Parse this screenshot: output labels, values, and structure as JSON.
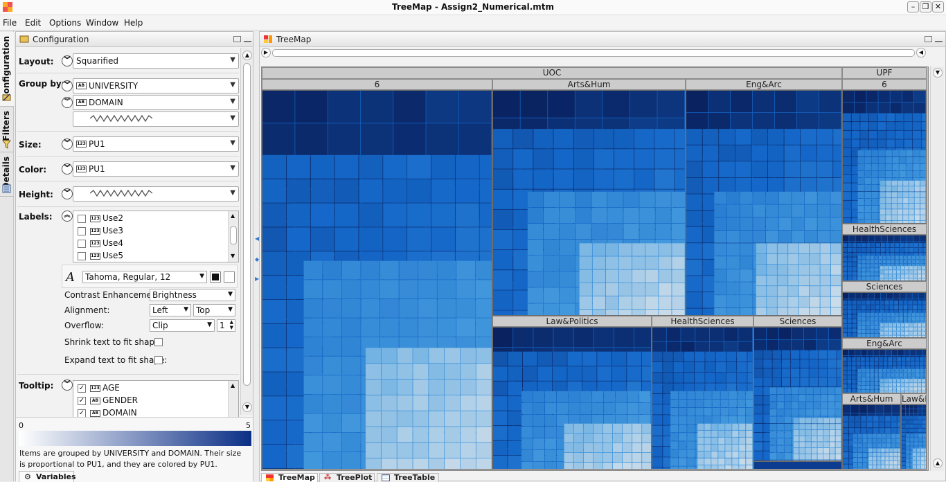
{
  "window": {
    "title": "TreeMap - Assign2_Numerical.mtm"
  },
  "menu": [
    "File",
    "Edit",
    "Options",
    "Window",
    "Help"
  ],
  "side_tabs": [
    "Configuration",
    "Filters",
    "Details"
  ],
  "config": {
    "panel_title": "Configuration",
    "layout_label": "Layout:",
    "layout_value": "Squarified",
    "group_label": "Group by:",
    "group_values": [
      "UNIVERSITY",
      "DOMAIN"
    ],
    "size_label": "Size:",
    "size_value": "PU1",
    "color_label": "Color:",
    "color_value": "PU1",
    "height_label": "Height:",
    "labels_label": "Labels:",
    "labels_items": [
      "Use2",
      "Use3",
      "Use4",
      "Use5"
    ],
    "font_value": "Tahoma, Regular, 12",
    "contrast_label": "Contrast Enhancement:",
    "contrast_value": "Brightness",
    "alignment_label": "Alignment:",
    "align_h": "Left",
    "align_v": "Top",
    "overflow_label": "Overflow:",
    "overflow_value": "Clip",
    "overflow_count": "1",
    "shrink_label": "Shrink text to fit shape:",
    "expand_label": "Expand text to fit shape:",
    "tooltip_label": "Tooltip:",
    "tooltip_items": [
      "AGE",
      "GENDER",
      "DOMAIN"
    ],
    "legend_min": "0",
    "legend_max": "5",
    "description": "Items are grouped by UNIVERSITY and DOMAIN. Their size is proportional to PU1, and they are colored by PU1.",
    "variables_tab": "Variables"
  },
  "treemap": {
    "panel_title": "TreeMap",
    "universities": [
      "UOC",
      "UPF"
    ],
    "uoc_domains": [
      "6",
      "Arts&Hum",
      "Eng&Arc",
      "Law&Politics",
      "HealthSciences",
      "Sciences"
    ],
    "upf_domains": [
      "6",
      "HealthSciences",
      "Sciences",
      "Eng&Arc",
      "Arts&Hum",
      "Law&F"
    ],
    "colors": {
      "dark": "#0a2260",
      "mid": "#1467c8",
      "light": "#4aa0e0",
      "pale": "#d8e2ea"
    }
  },
  "bottom_tabs": [
    "TreeMap",
    "TreePlot",
    "TreeTable"
  ]
}
